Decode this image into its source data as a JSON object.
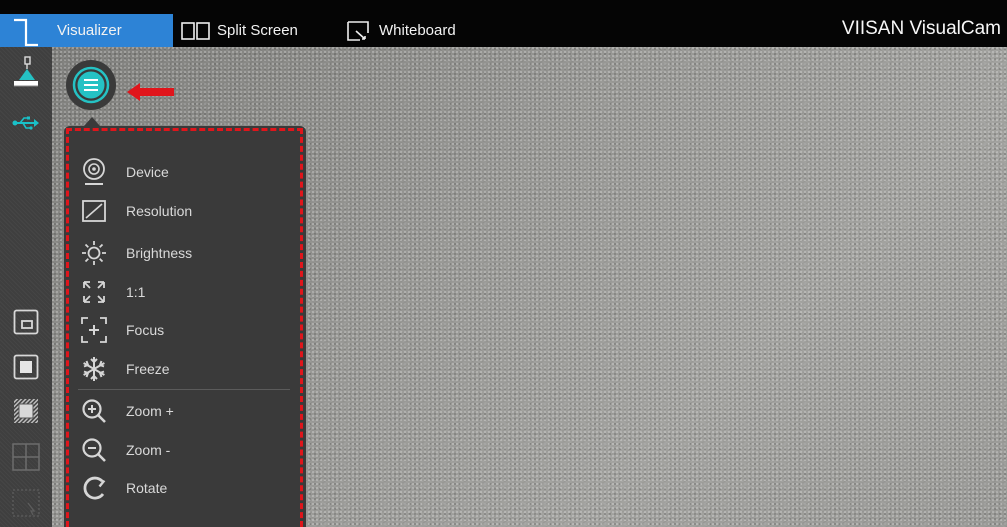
{
  "topbar": {
    "tabs": [
      {
        "label": "Visualizer",
        "active": true,
        "icon": "visualizer-icon"
      },
      {
        "label": "Split Screen",
        "active": false,
        "icon": "split-screen-icon"
      },
      {
        "label": "Whiteboard",
        "active": false,
        "icon": "whiteboard-icon"
      }
    ],
    "brand": "VIISAN VisualCam"
  },
  "leftbar": {
    "items": [
      {
        "name": "document-camera-icon"
      },
      {
        "name": "usb-icon"
      },
      {
        "name": "picture-in-picture-icon"
      },
      {
        "name": "stop-square-icon"
      },
      {
        "name": "crop-frame-icon"
      },
      {
        "name": "grid-quad-icon"
      },
      {
        "name": "select-region-icon"
      }
    ]
  },
  "menu": {
    "toggle_icon": "menu-list-icon",
    "items": [
      {
        "label": "Device",
        "icon": "webcam-icon"
      },
      {
        "label": "Resolution",
        "icon": "resolution-icon"
      },
      {
        "label": "Brightness",
        "icon": "brightness-icon"
      },
      {
        "label": "1:1",
        "icon": "actual-size-icon"
      },
      {
        "label": "Focus",
        "icon": "focus-icon"
      },
      {
        "label": "Freeze",
        "icon": "snowflake-icon"
      },
      {
        "label": "Zoom +",
        "icon": "zoom-in-icon"
      },
      {
        "label": "Zoom -",
        "icon": "zoom-out-icon"
      },
      {
        "label": "Rotate",
        "icon": "rotate-icon"
      }
    ]
  },
  "colors": {
    "accent_blue": "#2d83d6",
    "menu_toggle_teal": "#25c2c4",
    "usb_teal": "#19c1c8",
    "highlight_red": "#e0151b",
    "menu_bg": "#3a3a3a"
  }
}
